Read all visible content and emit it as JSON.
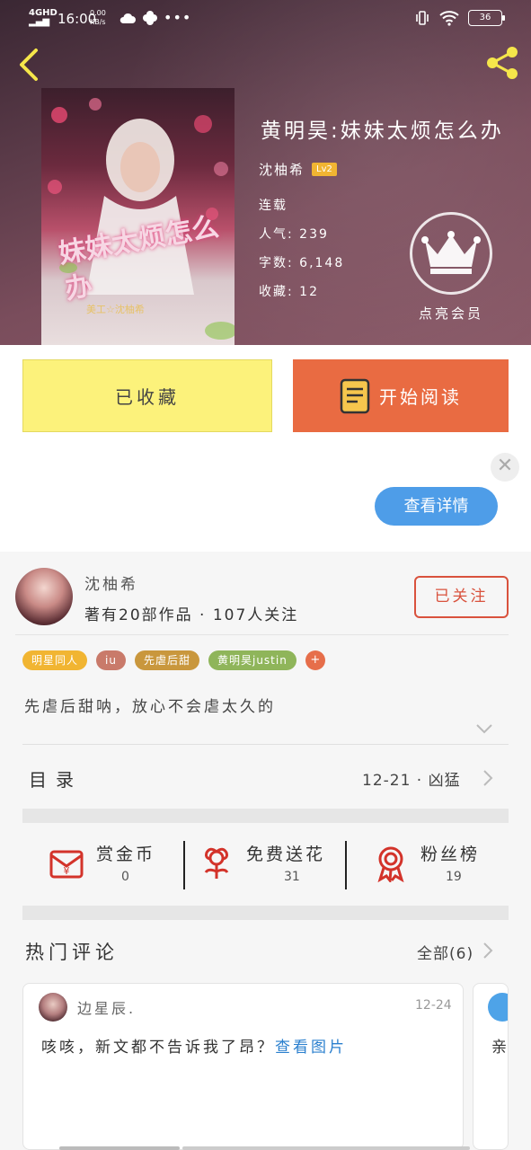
{
  "status_bar": {
    "network": "4GHD",
    "time": "16:00",
    "speed_value": "0.00",
    "speed_unit": "KB/s",
    "battery": "36"
  },
  "book": {
    "title": "黄明昊:妹妹太烦怎么办",
    "author": "沈柚希",
    "author_level": "Lv2",
    "status": "连载",
    "popularity_label": "人气:",
    "popularity": "239",
    "word_count_label": "字数:",
    "word_count": "6,148",
    "favorites_label": "收藏:",
    "favorites": "12",
    "cover_title": "妹妹太烦怎么办",
    "cover_subtitle": "美工☆沈柚希"
  },
  "vip": {
    "label": "点亮会员"
  },
  "actions": {
    "collected_label": "已收藏",
    "read_label": "开始阅读"
  },
  "ad": {
    "close_symbol": "✕",
    "details_label": "查看详情"
  },
  "author": {
    "name": "沈柚希",
    "stats": "著有20部作品 · 107人关注",
    "follow_label": "已关注"
  },
  "tags": [
    {
      "label": "明星同人",
      "color": "#f1b532"
    },
    {
      "label": "iu",
      "color": "#c97a6a"
    },
    {
      "label": "先虐后甜",
      "color": "#c9973d"
    },
    {
      "label": "黄明昊justin",
      "color": "#8fb55a"
    }
  ],
  "tag_more": "+",
  "intro": "先虐后甜呐，放心不会虐太久的",
  "toc": {
    "label": "目录",
    "latest": "12-21 · 凶猛"
  },
  "stats": [
    {
      "label": "赏金币",
      "value": "0",
      "icon": "red-envelope-icon"
    },
    {
      "label": "免费送花",
      "value": "31",
      "icon": "flower-icon"
    },
    {
      "label": "粉丝榜",
      "value": "19",
      "icon": "medal-icon"
    }
  ],
  "comments": {
    "title": "热门评论",
    "all_label": "全部(6)",
    "items": [
      {
        "user": "边星辰.",
        "date": "12-24",
        "text": "咳咳，新文都不告诉我了昂？",
        "link": "查看图片"
      },
      {
        "text": "亲"
      }
    ]
  },
  "colors": {
    "accent_orange": "#e96b42",
    "collected_yellow": "#fcf27b",
    "follow_red": "#d9523d",
    "link_blue": "#2a7fce",
    "details_blue": "#4e9de8"
  }
}
